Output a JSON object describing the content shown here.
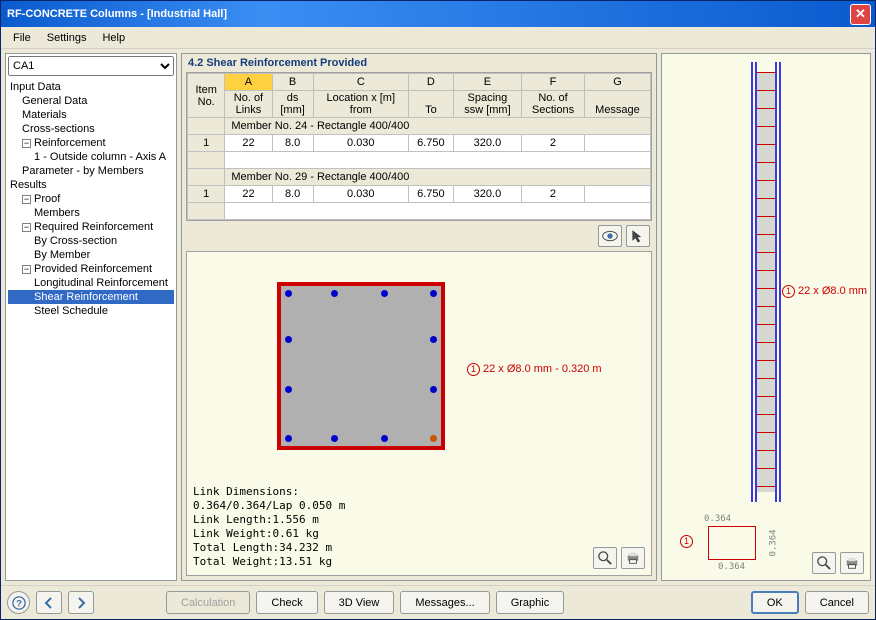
{
  "window": {
    "title": "RF-CONCRETE Columns - [Industrial Hall]"
  },
  "menu": {
    "file": "File",
    "settings": "Settings",
    "help": "Help"
  },
  "combo": {
    "value": "CA1"
  },
  "tree": {
    "input_data": "Input Data",
    "general_data": "General Data",
    "materials": "Materials",
    "cross_sections": "Cross-sections",
    "reinforcement": "Reinforcement",
    "reinf_1": "1 - Outside column - Axis A",
    "param_by_members": "Parameter - by Members",
    "results": "Results",
    "proof": "Proof",
    "members": "Members",
    "req_reinf": "Required Reinforcement",
    "by_cs": "By Cross-section",
    "by_member": "By Member",
    "prov_reinf": "Provided Reinforcement",
    "long_reinf": "Longitudinal Reinforcement",
    "shear_reinf": "Shear Reinforcement",
    "steel_sched": "Steel Schedule"
  },
  "section": {
    "title": "4.2 Shear Reinforcement Provided"
  },
  "table": {
    "cols": {
      "A": "A",
      "B": "B",
      "C": "C",
      "D": "D",
      "E": "E",
      "F": "F",
      "G": "G"
    },
    "h": {
      "item": "Item",
      "no": "No.",
      "no_of": "No. of",
      "links": "Links",
      "ds": "ds",
      "mm": "[mm]",
      "location": "Location x [m]",
      "from": "from",
      "to": "To",
      "spacing": "Spacing",
      "ssw": "ssw [mm]",
      "sections_no": "No. of",
      "sections": "Sections",
      "message": "Message"
    },
    "group1": "Member No. 24 - Rectangle 400/400",
    "group2": "Member No. 29 - Rectangle 400/400",
    "r1": {
      "idx": "1",
      "links": "22",
      "ds": "8.0",
      "from": "0.030",
      "to": "6.750",
      "spacing": "320.0",
      "sec": "2"
    },
    "r2": {
      "idx": "1",
      "links": "22",
      "ds": "8.0",
      "from": "0.030",
      "to": "6.750",
      "spacing": "320.0",
      "sec": "2"
    }
  },
  "drawing": {
    "annot1": "22 x Ø8.0 mm - 0.320 m",
    "annot_no": "1",
    "link_text": "Link Dimensions:\n0.364/0.364/Lap 0.050 m\nLink Length:1.556 m\nLink Weight:0.61 kg\nTotal Length:34.232 m\nTotal Weight:13.51 kg"
  },
  "right": {
    "annot": "22 x Ø8.0 mm",
    "annot_no": "1",
    "footing_no": "1",
    "dim_h": "0.364",
    "dim_v": "0.364",
    "dim_v2": "0.364"
  },
  "buttons": {
    "calculation": "Calculation",
    "check": "Check",
    "view3d": "3D View",
    "messages": "Messages...",
    "graphic": "Graphic",
    "ok": "OK",
    "cancel": "Cancel"
  }
}
